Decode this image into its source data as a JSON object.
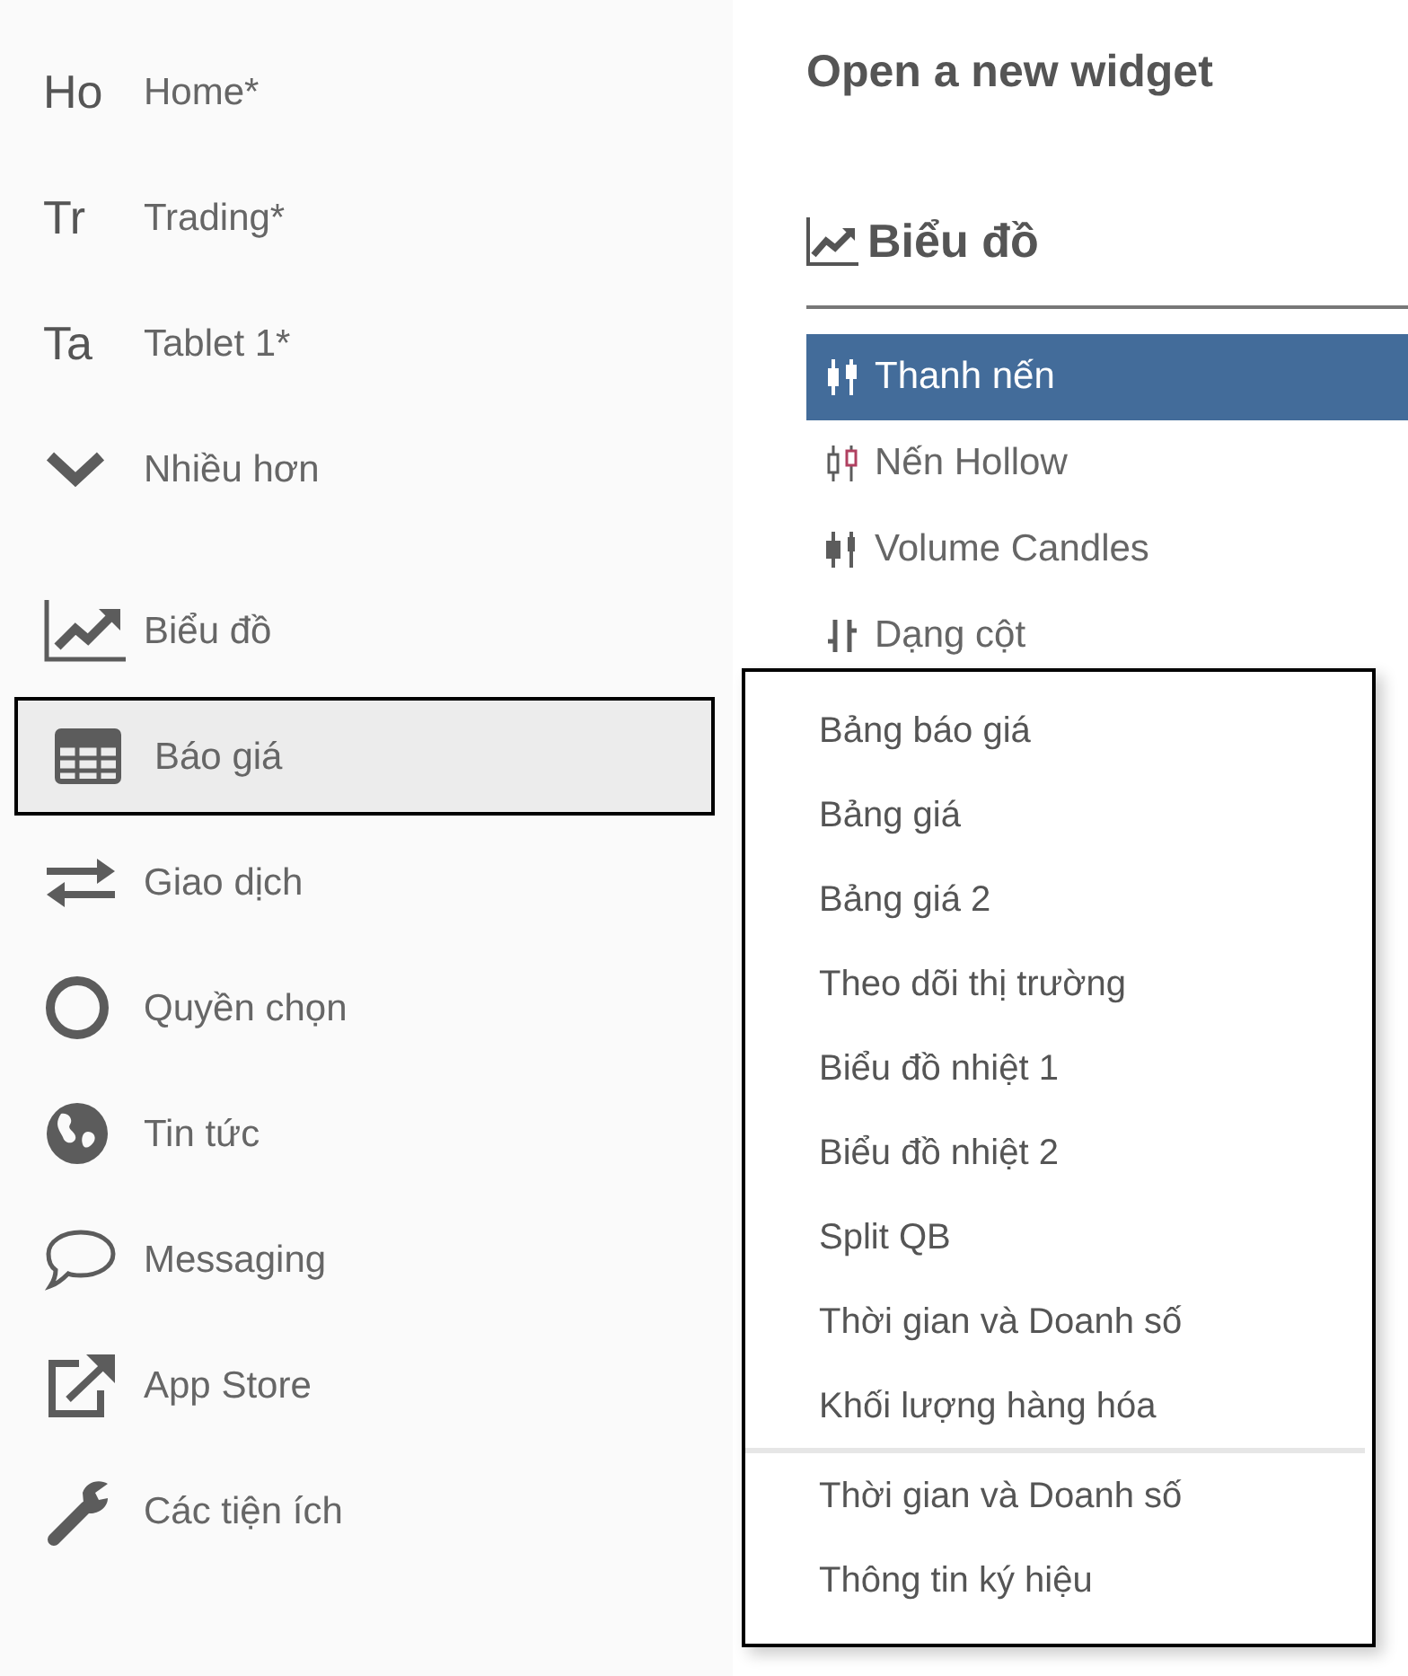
{
  "sidebar": {
    "items": [
      {
        "kind": "abbr",
        "abbr": "Ho",
        "label": "Home*",
        "selected": false
      },
      {
        "kind": "abbr",
        "abbr": "Tr",
        "label": "Trading*",
        "selected": false
      },
      {
        "kind": "abbr",
        "abbr": "Ta",
        "label": "Tablet 1*",
        "selected": false
      },
      {
        "kind": "chevron",
        "label": "Nhiều hơn",
        "selected": false
      },
      {
        "kind": "chart",
        "label": "Biểu đồ",
        "selected": false
      },
      {
        "kind": "table",
        "label": "Báo giá",
        "selected": true
      },
      {
        "kind": "swap",
        "label": "Giao dịch",
        "selected": false
      },
      {
        "kind": "circle",
        "label": "Quyền chọn",
        "selected": false
      },
      {
        "kind": "globe",
        "label": "Tin tức",
        "selected": false
      },
      {
        "kind": "chat",
        "label": "Messaging",
        "selected": false
      },
      {
        "kind": "external",
        "label": "App Store",
        "selected": false
      },
      {
        "kind": "wrench",
        "label": "Các tiện ích",
        "selected": false
      }
    ]
  },
  "panel": {
    "title": "Open a new widget",
    "section": "Biểu đồ",
    "items": [
      {
        "kind": "candles",
        "label": "Thanh nến",
        "selected": true
      },
      {
        "kind": "hollow",
        "label": "Nến Hollow",
        "selected": false
      },
      {
        "kind": "volume",
        "label": "Volume Candles",
        "selected": false
      },
      {
        "kind": "column",
        "label": "Dạng cột",
        "selected": false
      }
    ]
  },
  "popup_menu": {
    "groups": [
      [
        "Bảng báo giá",
        "Bảng giá",
        "Bảng giá 2",
        "Theo dõi thị trường",
        "Biểu đồ nhiệt 1",
        "Biểu đồ nhiệt 2",
        "Split QB",
        "Thời gian và Doanh số",
        "Khối lượng hàng hóa"
      ],
      [
        "Thời gian và Doanh số",
        "Thông tin ký hiệu"
      ]
    ]
  }
}
